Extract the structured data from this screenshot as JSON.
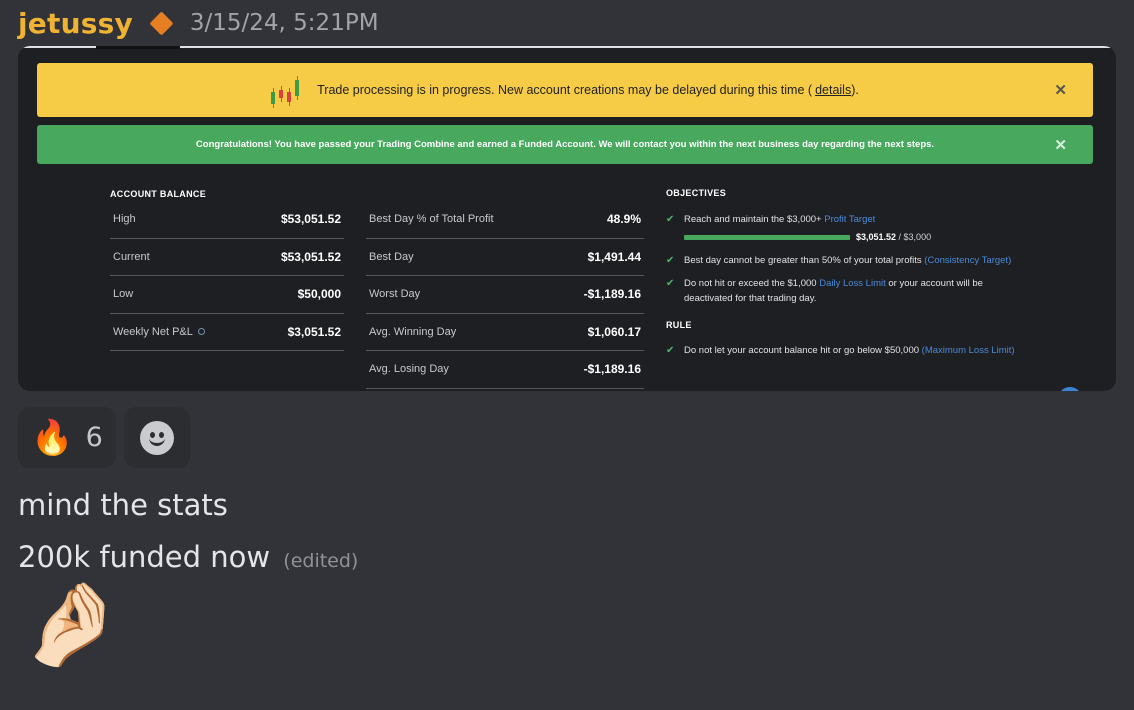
{
  "message": {
    "username": "jetussy",
    "role_icon": "diamond-role-icon",
    "timestamp": "3/15/24, 5:21PM"
  },
  "embed": {
    "banner_processing": {
      "text": "Trade processing is in progress. New account creations may be delayed during this time (",
      "link": "details",
      "suffix": ").",
      "close": "✕",
      "color": "#f6cb45"
    },
    "banner_congrats": {
      "text": "Congratulations! You have passed your Trading Combine and earned a Funded Account. We will contact you within the next business day regarding the next steps.",
      "close": "✕",
      "color": "#47a85e"
    },
    "account_balance": {
      "title": "ACCOUNT BALANCE",
      "rows": [
        {
          "label": "High",
          "value": "$53,051.52"
        },
        {
          "label": "Current",
          "value": "$53,051.52"
        },
        {
          "label": "Low",
          "value": "$50,000"
        },
        {
          "label": "Weekly Net P&L",
          "value": "$3,051.52"
        }
      ]
    },
    "day_stats": {
      "rows": [
        {
          "label": "Best Day % of Total Profit",
          "value": "48.9%"
        },
        {
          "label": "Best Day",
          "value": "$1,491.44"
        },
        {
          "label": "Worst Day",
          "value": "-$1,189.16"
        },
        {
          "label": "Avg. Winning Day",
          "value": "$1,060.17"
        },
        {
          "label": "Avg. Losing Day",
          "value": "-$1,189.16"
        }
      ]
    },
    "objectives": {
      "title": "OBJECTIVES",
      "items": [
        {
          "text": "Reach and maintain the $3,000+ ",
          "link": "Profit Target",
          "after": ""
        },
        {
          "text": "Best day cannot be greater than 50% of your total profits ",
          "link": "(Consistency Target)",
          "after": ""
        },
        {
          "text": "Do not hit or exceed the $1,000 ",
          "link": "Daily Loss Limit",
          "after": " or your account will be deactivated for that trading day."
        }
      ],
      "progress": {
        "current": "$3,051.52",
        "target": " / $3,000",
        "fraction": 1.0
      }
    },
    "rule": {
      "title": "RULE",
      "items": [
        {
          "text": "Do not let your account balance hit or go below $50,000 ",
          "link": "(Maximum Loss Limit)"
        }
      ]
    }
  },
  "reactions": [
    {
      "emoji": "🔥",
      "count": "6"
    }
  ],
  "lines": [
    {
      "text": "mind the stats"
    },
    {
      "text": "200k funded now",
      "edited": "(edited)"
    }
  ],
  "final_emoji": "🤌🏻",
  "colors": {
    "background": "#313338",
    "username": "#f0b232",
    "link": "#4a8ad6"
  }
}
